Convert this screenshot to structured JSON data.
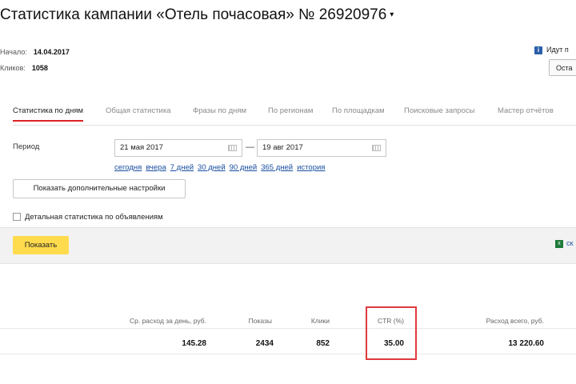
{
  "header": {
    "title": "Статистика кампании «Отель почасовая» № 26920976",
    "caret": "▾"
  },
  "meta": {
    "start_label": "Начало:",
    "start_value": "14.04.2017",
    "clicks_label": "Кликов:",
    "clicks_value": "1058"
  },
  "status": {
    "icon": "i",
    "text": "Идут п",
    "stop_button": "Оста"
  },
  "tabs": [
    {
      "label": "Статистика по дням",
      "active": true
    },
    {
      "label": "Общая статистика"
    },
    {
      "label": "Фразы по дням"
    },
    {
      "label": "По регионам"
    },
    {
      "label": "По площадкам"
    },
    {
      "label": "Поисковые запросы"
    },
    {
      "label": "Мастер отчётов"
    }
  ],
  "period": {
    "label": "Период",
    "from": "21 мая 2017",
    "dash": "—",
    "to": "19 авг 2017"
  },
  "quick_links": [
    "сегодня",
    "вчера",
    "7 дней",
    "30 дней",
    "90 дней",
    "365 дней",
    "история"
  ],
  "settings_button": "Показать дополнительные настройки",
  "detail_checkbox_label": "Детальная статистика по объявлениям",
  "show_button": "Показать",
  "excel": {
    "icon": "x",
    "link": "ск"
  },
  "table": {
    "headers": [
      "Ср. расход за день, руб.",
      "Показы",
      "Клики",
      "CTR (%)",
      "Расход всего, руб."
    ],
    "row": [
      "145.28",
      "2434",
      "852",
      "35.00",
      "13 220.60"
    ]
  },
  "colors": {
    "accent_tab": "#dd2222",
    "highlight": "#e0393e",
    "show_button": "#ffdb4d",
    "link": "#1a4fa0"
  }
}
